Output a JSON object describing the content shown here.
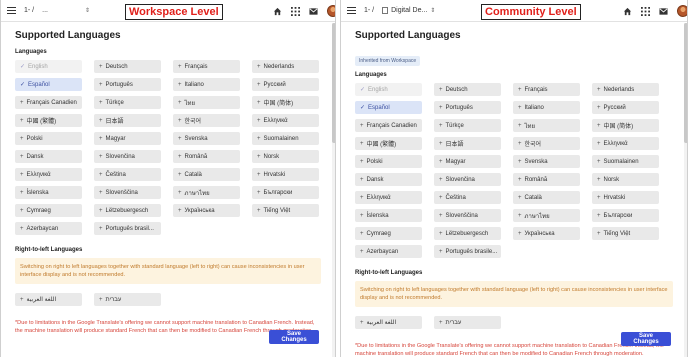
{
  "workspace": {
    "level_label": "Workspace Level",
    "breadcrumb": "1- /",
    "breadcrumb_select": "...",
    "page_title": "Supported Languages",
    "languages_label": "Languages",
    "languages": [
      [
        "English",
        "Deutsch",
        "Français",
        "Nederlands"
      ],
      [
        "Español",
        "Português",
        "Italiano",
        "Русский"
      ],
      [
        "Français Canadien",
        "Türkçe",
        "ไทย",
        "中国 (简体)"
      ],
      [
        "中國 (繁體)",
        "日本語",
        "한국어",
        "Ελληνικά"
      ],
      [
        "Polski",
        "Magyar",
        "Svenska",
        "Suomalainen"
      ],
      [
        "Dansk",
        "Slovenčina",
        "Română",
        "Norsk"
      ],
      [
        "Ελληνικά",
        "Čeština",
        "Català",
        "Hrvatski"
      ],
      [
        "Íslenska",
        "Slovenščina",
        "ภาษาไทย",
        "Български"
      ],
      [
        "Cymraeg",
        "Lëtzebuergesch",
        "Українська",
        "Tiếng Việt"
      ],
      [
        "Azerbaycan",
        "Português brasil...",
        "",
        ""
      ]
    ],
    "rtl_title": "Right-to-left Languages",
    "warning": "Switching on right to left languages together with standard language (left to right) can cause inconsistencies in user interface display and is not recommended.",
    "rtl_languages": [
      "اللغة العربية",
      "עברית"
    ],
    "footnote": "*Due to limitations in the Google Translate's offering we cannot support machine translation to Canadian French. Instead, the machine translation will produce standard French that can then be modified to Canadian French through moderation.",
    "save_label": "Save Changes"
  },
  "community": {
    "level_label": "Community Level",
    "breadcrumb": "1- /",
    "breadcrumb_select": "Digital De...",
    "page_title": "Supported Languages",
    "inherited_badge": "Inherited from Workspace",
    "languages_label": "Languages",
    "languages": [
      [
        "English",
        "Deutsch",
        "Français",
        "Nederlands"
      ],
      [
        "Español",
        "Português",
        "Italiano",
        "Русский"
      ],
      [
        "Français Canadien",
        "Türkçe",
        "ไทย",
        "中国 (简体)"
      ],
      [
        "中國 (繁體)",
        "日本語",
        "한국어",
        "Ελληνικά"
      ],
      [
        "Polski",
        "Magyar",
        "Svenska",
        "Suomalainen"
      ],
      [
        "Dansk",
        "Slovenčina",
        "Română",
        "Norsk"
      ],
      [
        "Ελληνικά",
        "Čeština",
        "Català",
        "Hrvatski"
      ],
      [
        "Íslenska",
        "Slovenščina",
        "ภาษาไทย",
        "Български"
      ],
      [
        "Cymraeg",
        "Lëtzebuergesch",
        "Українська",
        "Tiếng Việt"
      ],
      [
        "Azerbaycan",
        "Português brasile...",
        "",
        ""
      ]
    ],
    "rtl_title": "Right-to-left Languages",
    "warning": "Switching on right to left languages together with standard language (left to right) can cause inconsistencies in user interface display and is not recommended.",
    "rtl_languages": [
      "اللغة العربية",
      "עברית"
    ],
    "footnote": "*Due to limitations in the Google Translate's offering we cannot support machine translation to Canadian French. Instead, the machine translation will produce standard French that can then be modified to Canadian French through moderation.",
    "save_label": "Save Changes"
  },
  "icons": {
    "menu": "hamburger-menu-icon",
    "home": "home-icon",
    "apps": "apps-grid-icon",
    "mail": "mail-icon",
    "check": "check-icon",
    "plus": "plus-icon"
  },
  "colors": {
    "level_label": "#e0201b",
    "selected_chip": "#dbe4f7",
    "save_button": "#3a4fd6",
    "warning_bg": "#fdf3df",
    "warning_text": "#c07a2b",
    "footnote": "#d6453b"
  }
}
